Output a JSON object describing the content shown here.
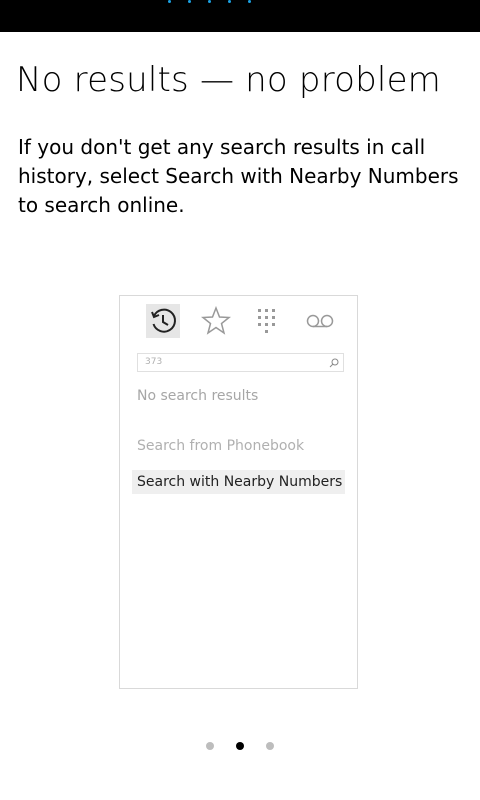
{
  "page": {
    "title": "No results — no problem",
    "description": "If you don't get any search results in call history, select Search with Nearby Numbers to search online."
  },
  "illustration": {
    "tabs": [
      {
        "icon": "history-icon",
        "active": true
      },
      {
        "icon": "star-icon",
        "active": false
      },
      {
        "icon": "dialpad-icon",
        "active": false
      },
      {
        "icon": "voicemail-icon",
        "active": false
      }
    ],
    "search_value": "373",
    "no_results_label": "No search results",
    "phonebook_label": "Search from Phonebook",
    "nearby_label": "Search with Nearby Numbers"
  },
  "pager": {
    "count": 3,
    "active_index": 1
  },
  "colors": {
    "accent": "#1ba1e2",
    "statusbar": "#000000"
  }
}
